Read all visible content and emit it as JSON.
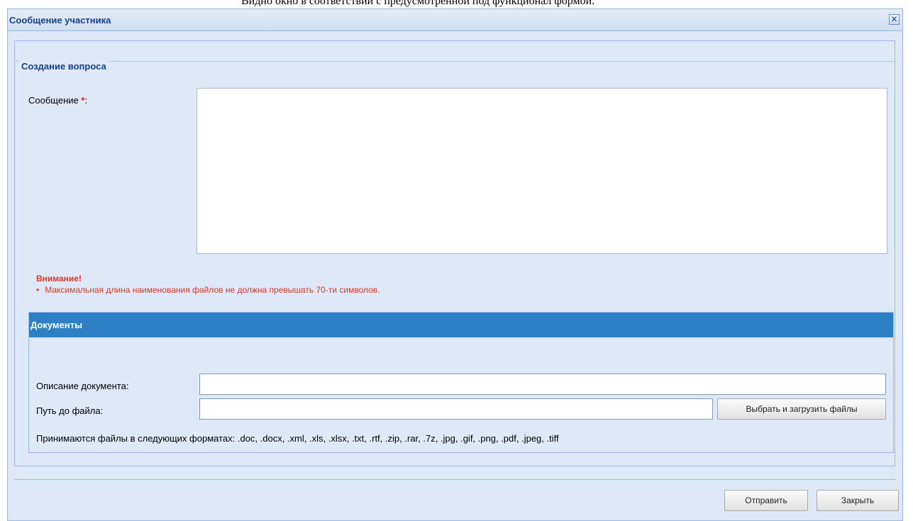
{
  "background_text": "Видно окно в соответствии с предусмотренной под функционал формой.",
  "window": {
    "title": "Сообщение участника",
    "close_symbol": "✕"
  },
  "form": {
    "legend": "Создание вопроса",
    "message_label": "Сообщение",
    "required_marker": "*",
    "label_colon": ":",
    "message_value": ""
  },
  "warning": {
    "title": "Внимание!",
    "items": [
      "Максимальная длина наименования файлов не должна превышать 70-ти символов."
    ]
  },
  "documents": {
    "title": "Документы",
    "description_label": "Описание документа:",
    "description_value": "",
    "path_label": "Путь до файла:",
    "path_value": "",
    "upload_button": "Выбрать и загрузить файлы",
    "formats_text": "Принимаются файлы в следующих форматах: .doc, .docx, .xml, .xls, .xlsx, .txt, .rtf, .zip, .rar, .7z, .jpg, .gif, .png, .pdf, .jpeg, .tiff"
  },
  "footer": {
    "send_button": "Отправить",
    "close_button": "Закрыть"
  },
  "colors": {
    "window_bg": "#dfe8f6",
    "title_text": "#15428b",
    "docs_header": "#2c80c3",
    "warning_text": "#d9382c",
    "required": "#e02020"
  }
}
